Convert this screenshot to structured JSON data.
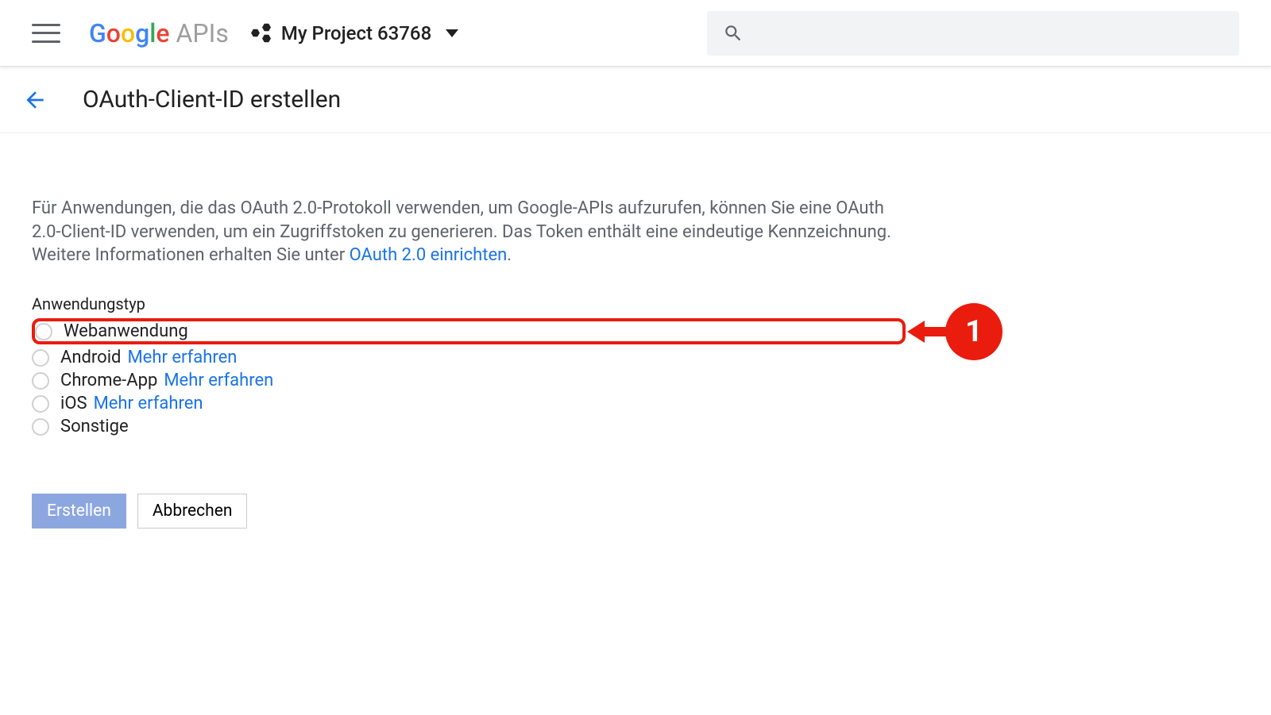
{
  "header": {
    "logo_product": "APIs",
    "project_name": "My Project 63768"
  },
  "subheader": {
    "title": "OAuth-Client-ID erstellen"
  },
  "description": {
    "text_before_link": "Für Anwendungen, die das OAuth 2.0-Protokoll verwenden, um Google-APIs aufzurufen, können Sie eine OAuth 2.0-Client-ID verwenden, um ein Zugriffstoken zu generieren. Das Token enthält eine eindeutige Kennzeichnung. Weitere Informationen erhalten Sie unter ",
    "link_text": "OAuth 2.0 einrichten",
    "text_after_link": "."
  },
  "form": {
    "type_label": "Anwendungstyp",
    "options": {
      "web": "Webanwendung",
      "android": "Android",
      "chrome": "Chrome-App",
      "ios": "iOS",
      "other": "Sonstige"
    },
    "learn_more": "Mehr erfahren"
  },
  "annotation": {
    "number": "1"
  },
  "buttons": {
    "create": "Erstellen",
    "cancel": "Abbrechen"
  }
}
